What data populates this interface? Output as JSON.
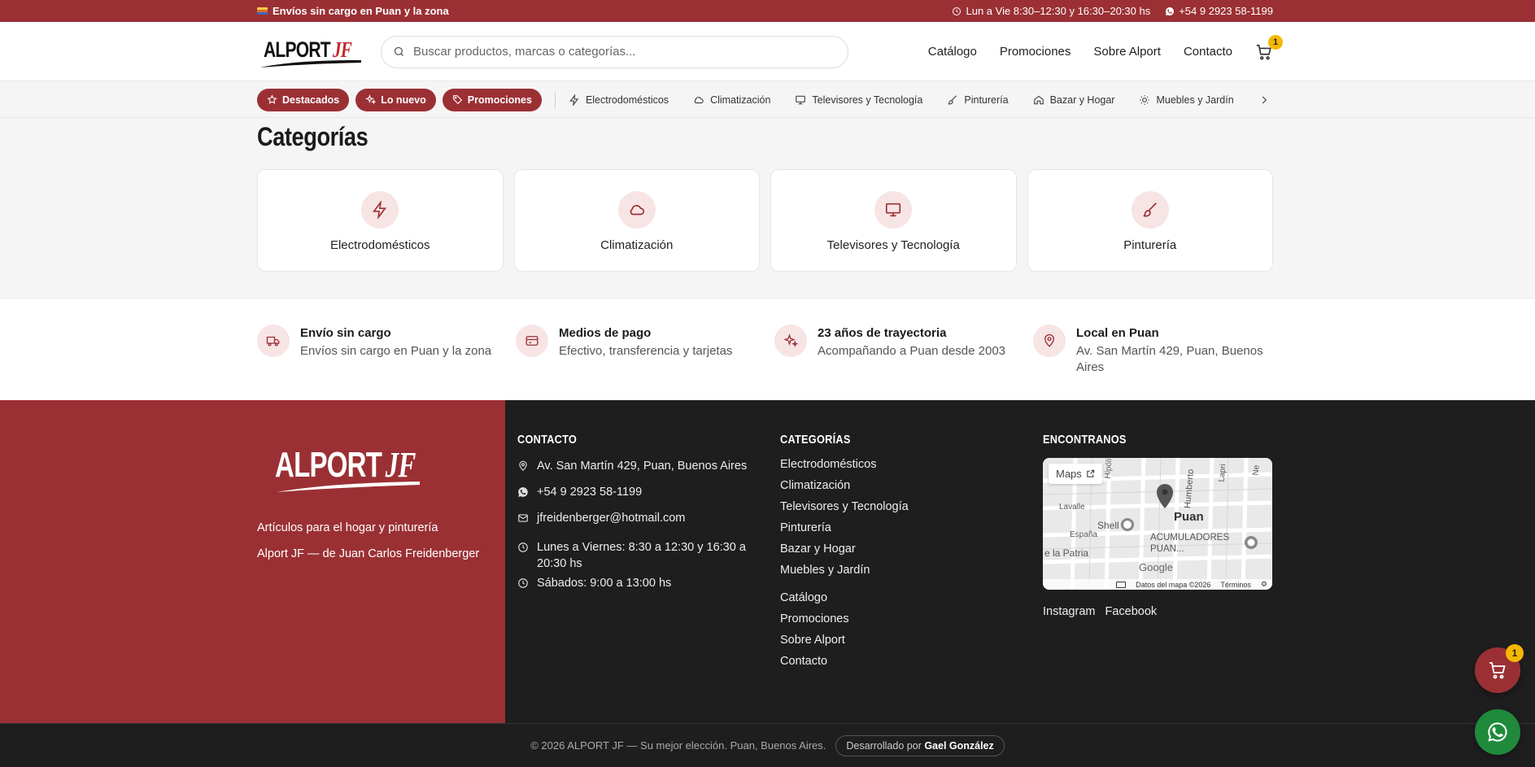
{
  "topbar": {
    "shipping": "Envíos sin cargo en Puan y la zona",
    "hours": "Lun a Vie 8:30–12:30 y 16:30–20:30 hs",
    "phone": "+54 9 2923 58-1199"
  },
  "header": {
    "logo_text": "ALPORT",
    "logo_suffix": "JF",
    "search_placeholder": "Buscar productos, marcas o categorías...",
    "nav": [
      "Catálogo",
      "Promociones",
      "Sobre Alport",
      "Contacto"
    ],
    "cart_count": "1"
  },
  "catbar": {
    "pills": [
      "Destacados",
      "Lo nuevo",
      "Promociones"
    ],
    "items": [
      {
        "label": "Electrodomésticos",
        "icon": "bolt-icon"
      },
      {
        "label": "Climatización",
        "icon": "cloud-icon"
      },
      {
        "label": "Televisores y Tecnología",
        "icon": "monitor-icon"
      },
      {
        "label": "Pinturería",
        "icon": "brush-icon"
      },
      {
        "label": "Bazar y Hogar",
        "icon": "home-icon"
      },
      {
        "label": "Muebles y Jardín",
        "icon": "sun-icon"
      }
    ]
  },
  "categories": {
    "title": "Categorías",
    "cards": [
      "Electrodomésticos",
      "Climatización",
      "Televisores y Tecnología",
      "Pinturería"
    ]
  },
  "features": [
    {
      "title": "Envío sin cargo",
      "text": "Envíos sin cargo en Puan y la zona",
      "icon": "truck-icon"
    },
    {
      "title": "Medios de pago",
      "text": "Efectivo, transferencia y tarjetas",
      "icon": "card-icon"
    },
    {
      "title": "23 años de trayectoria",
      "text": "Acompañando a Puan desde 2003",
      "icon": "sparkles-icon"
    },
    {
      "title": "Local en Puan",
      "text": "Av. San Martín 429, Puan, Buenos Aires",
      "icon": "pin-icon"
    }
  ],
  "footer": {
    "logo_text": "ALPORT",
    "logo_suffix": "JF",
    "tagline": "Artículos para el hogar y pinturería",
    "owner": "Alport JF — de Juan Carlos Freidenberger",
    "contact_title": "CONTACTO",
    "address": "Av. San Martín 429, Puan, Buenos Aires",
    "phone": "+54 9 2923 58-1199",
    "email": "jfreidenberger@hotmail.com",
    "weekday_hours": "Lunes a Viernes: 8:30 a 12:30 y 16:30 a 20:30 hs",
    "saturday_hours": "Sábados: 9:00 a 13:00 hs",
    "categories_title": "CATEGORÍAS",
    "category_links": [
      "Electrodomésticos",
      "Climatización",
      "Televisores y Tecnología",
      "Pinturería",
      "Bazar y Hogar",
      "Muebles y Jardín"
    ],
    "page_links": [
      "Catálogo",
      "Promociones",
      "Sobre Alport",
      "Contacto"
    ],
    "find_title": "ENCONTRANOS",
    "map": {
      "maps_button": "Maps",
      "city": "Puan",
      "shop_label": "ACUMULADORES PUAN...",
      "gas_label": "Shell",
      "streets": [
        "Lavalle",
        "España",
        "e la Patria",
        "Hipólito",
        "Humberto",
        "Lapri",
        "Ne"
      ],
      "attribution": "Datos del mapa ©2026",
      "terms": "Términos",
      "google": "Google"
    },
    "social": [
      "Instagram",
      "Facebook"
    ]
  },
  "bottom": {
    "copyright": "© 2026 ALPORT JF — Su mejor elección. Puan, Buenos Aires.",
    "dev_prefix": "Desarrollado por",
    "dev_name": "Gael González"
  },
  "floating": {
    "cart_count": "1"
  },
  "colors": {
    "brand": "#9b3034",
    "badge": "#f5b800",
    "whatsapp": "#1f8a3b",
    "footer_dark": "#1e1e1f"
  }
}
